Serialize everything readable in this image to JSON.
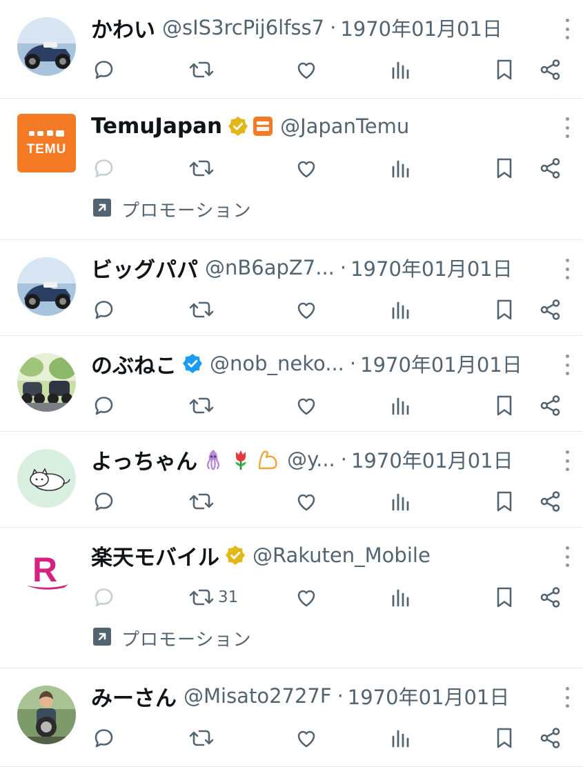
{
  "tweets": [
    {
      "name": "かわい",
      "handle": "@sIS3rcPij6lfss7",
      "date": "1970年01月01日",
      "retweet_count": "",
      "promoted": false,
      "badge": "",
      "emojis": [],
      "avatar_icon": "motorcycle-avatar-icon"
    },
    {
      "name": "TemuJapan",
      "handle": "@JapanTemu",
      "date": "",
      "retweet_count": "",
      "promoted": true,
      "promo_label": "プロモーション",
      "badge": "gold",
      "emojis": [
        "temu-logo-icon"
      ],
      "avatar_icon": "temu-logo-avatar-icon",
      "avatar_text": "TEMU"
    },
    {
      "name": "ビッグパパ",
      "handle": "@nB6apZ7...",
      "date": "1970年01月01日",
      "retweet_count": "",
      "promoted": false,
      "badge": "",
      "emojis": [],
      "avatar_icon": "motorcycle-avatar-icon"
    },
    {
      "name": "のぶねこ",
      "handle": "@nob_neko...",
      "date": "1970年01月01日",
      "retweet_count": "",
      "promoted": false,
      "badge": "blue",
      "emojis": [],
      "avatar_icon": "riders-avatar-icon"
    },
    {
      "name": "よっちゃん",
      "handle": "@y...",
      "date": "1970年01月01日",
      "retweet_count": "",
      "promoted": false,
      "badge": "",
      "emojis": [
        "squid-icon",
        "tulip-icon",
        "muscle-icon"
      ],
      "avatar_icon": "cat-avatar-icon"
    },
    {
      "name": "楽天モバイル",
      "handle": "@Rakuten_Mobile",
      "date": "",
      "retweet_count": "31",
      "promoted": true,
      "promo_label": "プロモーション",
      "badge": "gold",
      "emojis": [],
      "avatar_icon": "rakuten-logo-avatar-icon",
      "avatar_text": "R"
    },
    {
      "name": "みーさん",
      "handle": "@Misato2727F",
      "date": "1970年01月01日",
      "retweet_count": "",
      "promoted": false,
      "badge": "",
      "emojis": [],
      "avatar_icon": "person-motorcycle-avatar-icon"
    }
  ],
  "separator": "·",
  "action_icons": [
    "reply-icon",
    "retweet-icon",
    "like-icon",
    "views-icon",
    "bookmark-icon",
    "share-icon"
  ],
  "colors": {
    "text": "#0f1419",
    "secondary": "#536471",
    "gold_badge": "#e2b719",
    "blue_badge": "#1d9bf0",
    "temu_orange": "#f47a25",
    "rakuten_pink": "#d3237f"
  }
}
